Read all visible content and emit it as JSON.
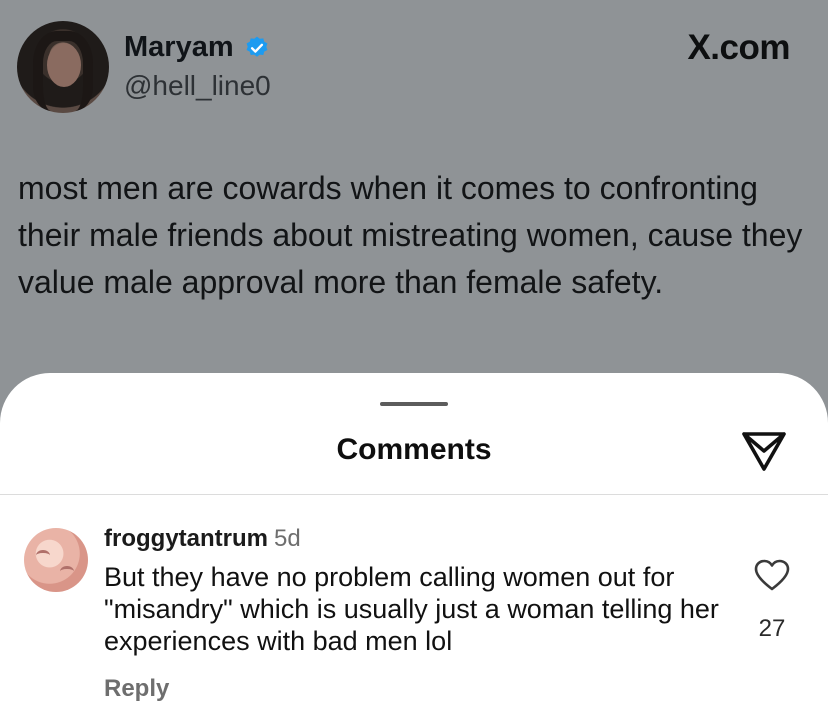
{
  "tweet": {
    "author_name": "Maryam",
    "handle": "@hell_line0",
    "source_label": "X.com",
    "text": "most men are cowards when it comes to confronting their male friends about mistreating women, cause they value male approval more than female safety.",
    "verified_color": "#1d9bf0"
  },
  "comments_sheet": {
    "title": "Comments",
    "comments": [
      {
        "username": "froggytantrum",
        "time_ago": "5d",
        "text": "But they have no problem calling women out for \"misandry\" which is usually just a woman telling her experiences with bad men lol",
        "like_count": "27",
        "reply_label": "Reply"
      }
    ]
  },
  "icons": {
    "verified": "verified-badge-icon",
    "send": "send-icon",
    "like": "heart-icon"
  }
}
